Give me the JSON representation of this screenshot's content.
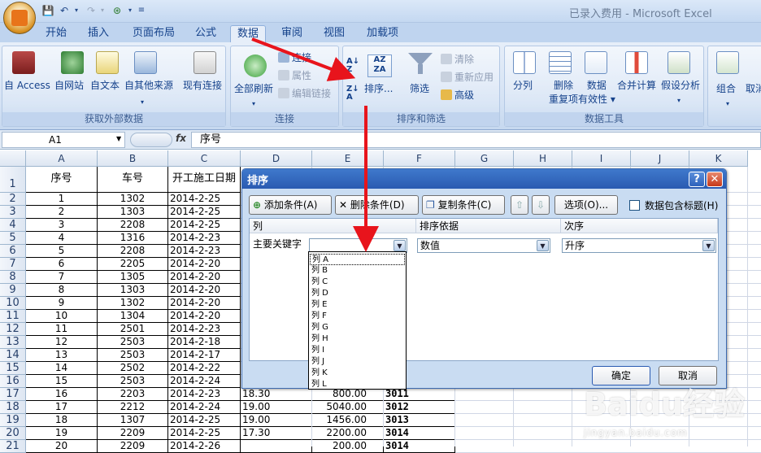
{
  "window": {
    "title": "已录入费用 - Microsoft Excel"
  },
  "ribbon_tabs": [
    "开始",
    "插入",
    "页面布局",
    "公式",
    "数据",
    "审阅",
    "视图",
    "加载项"
  ],
  "active_tab": "数据",
  "groups": {
    "external": {
      "label": "获取外部数据",
      "buttons": [
        "自 Access",
        "自网站",
        "自文本",
        "自其他来源",
        "现有连接"
      ]
    },
    "connections": {
      "label": "连接",
      "refresh": "全部刷新",
      "items": [
        "连接",
        "属性",
        "编辑链接"
      ]
    },
    "sortfilter": {
      "label": "排序和筛选",
      "sort_asc_icon": "A↓Z",
      "sort": "排序...",
      "filter": "筛选",
      "items": [
        "清除",
        "重新应用",
        "高级"
      ]
    },
    "datatools": {
      "label": "数据工具",
      "buttons": [
        "分列",
        "删除",
        "重复项",
        "数据",
        "有效性",
        "合并计算",
        "假设分析"
      ]
    },
    "outline": {
      "buttons": [
        "组合",
        "取消"
      ]
    }
  },
  "formula_bar": {
    "namebox": "A1",
    "fx": "fx",
    "formula": "序号"
  },
  "columns": [
    "A",
    "B",
    "C",
    "D",
    "E",
    "F",
    "G",
    "H",
    "I",
    "J",
    "K"
  ],
  "rows": [
    "1",
    "2",
    "3",
    "4",
    "5",
    "6",
    "7",
    "8",
    "9",
    "10",
    "11",
    "12",
    "13",
    "14",
    "15",
    "16",
    "17",
    "18",
    "19",
    "20",
    "21"
  ],
  "header_row": [
    "序号",
    "车号",
    "开工施工日期"
  ],
  "data_rows": [
    [
      "1",
      "1302",
      "2014-2-25"
    ],
    [
      "2",
      "1303",
      "2014-2-25"
    ],
    [
      "3",
      "2208",
      "2014-2-25"
    ],
    [
      "4",
      "1316",
      "2014-2-23"
    ],
    [
      "5",
      "2208",
      "2014-2-23"
    ],
    [
      "6",
      "2205",
      "2014-2-20"
    ],
    [
      "7",
      "1305",
      "2014-2-20"
    ],
    [
      "8",
      "1303",
      "2014-2-20"
    ],
    [
      "9",
      "1302",
      "2014-2-20"
    ],
    [
      "10",
      "1304",
      "2014-2-20"
    ],
    [
      "11",
      "2501",
      "2014-2-23"
    ],
    [
      "12",
      "2503",
      "2014-2-18"
    ],
    [
      "13",
      "2503",
      "2014-2-17"
    ],
    [
      "14",
      "2502",
      "2014-2-22"
    ],
    [
      "15",
      "2503",
      "2014-2-24"
    ],
    [
      "16",
      "2203",
      "2014-2-23"
    ],
    [
      "17",
      "2212",
      "2014-2-24"
    ],
    [
      "18",
      "1307",
      "2014-2-25"
    ],
    [
      "19",
      "2209",
      "2014-2-25"
    ],
    [
      "20",
      "2209",
      "2014-2-26"
    ]
  ],
  "extra_rows": [
    {
      "d": "18.30",
      "e": "800.00",
      "f": "3011"
    },
    {
      "d": "19.00",
      "e": "5040.00",
      "f": "3012"
    },
    {
      "d": "19.00",
      "e": "1456.00",
      "f": "3013"
    },
    {
      "d": "17.30",
      "e": "2200.00",
      "f": "3014"
    },
    {
      "d": "",
      "e": "200.00",
      "f": "3014"
    }
  ],
  "sort_dialog": {
    "title": "排序",
    "help": "?",
    "close": "✕",
    "add_level": "添加条件(A)",
    "delete_level": "删除条件(D)",
    "copy_level": "复制条件(C)",
    "options": "选项(O)...",
    "has_headers": "数据包含标题(H)",
    "col_header": "列",
    "sort_on_header": "排序依据",
    "order_header": "次序",
    "row_label": "主要关键字",
    "sort_on_value": "数值",
    "order_value": "升序",
    "ok": "确定",
    "cancel": "取消"
  },
  "dropdown_items": [
    "列 A",
    "列 B",
    "列 C",
    "列 D",
    "列 E",
    "列 F",
    "列 G",
    "列 H",
    "列 I",
    "列 J",
    "列 K",
    "列 L"
  ],
  "watermark": {
    "main": "Baidu经验",
    "sub": "jingyan.baidu.com"
  },
  "colors": {
    "arrow": "#e8141c",
    "accent": "#15428b"
  }
}
